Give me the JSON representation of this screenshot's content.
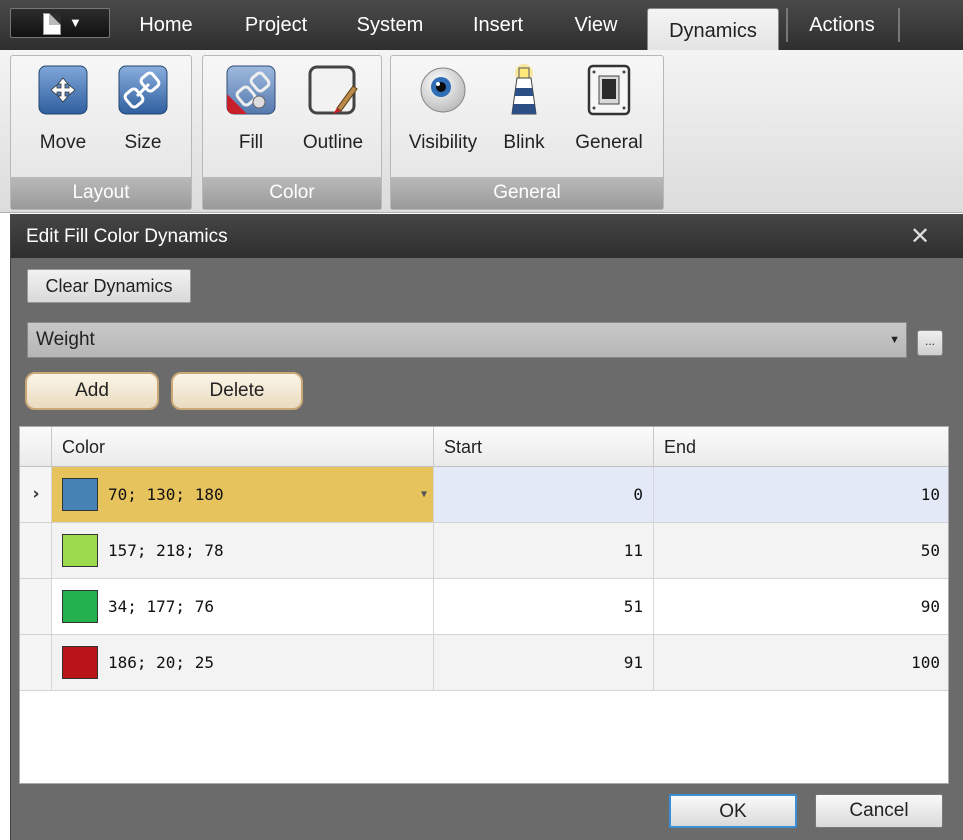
{
  "ribbon": {
    "tabs": [
      "Home",
      "Project",
      "System",
      "Insert",
      "View",
      "Dynamics",
      "Actions"
    ],
    "active_tab": "Dynamics",
    "groups": {
      "layout": {
        "label": "Layout",
        "buttons": [
          "Move",
          "Size"
        ]
      },
      "color": {
        "label": "Color",
        "buttons": [
          "Fill",
          "Outline"
        ]
      },
      "general": {
        "label": "General",
        "buttons": [
          "Visibility",
          "Blink",
          "General"
        ]
      }
    }
  },
  "dialog": {
    "title": "Edit Fill Color Dynamics",
    "clear_label": "Clear Dynamics",
    "source_value": "Weight",
    "browse_label": "...",
    "add_label": "Add",
    "delete_label": "Delete",
    "ok_label": "OK",
    "cancel_label": "Cancel"
  },
  "grid": {
    "columns": [
      "Color",
      "Start",
      "End"
    ],
    "rows": [
      {
        "color_text": "70; 130; 180",
        "swatch": "#4682B4",
        "start": "0",
        "end": "10",
        "current": true
      },
      {
        "color_text": "157; 218; 78",
        "swatch": "#9DDA4E",
        "start": "11",
        "end": "50",
        "current": false
      },
      {
        "color_text": "34; 177; 76",
        "swatch": "#22B14C",
        "start": "51",
        "end": "90",
        "current": false
      },
      {
        "color_text": "186; 20; 25",
        "swatch": "#BA1419",
        "start": "91",
        "end": "100",
        "current": false
      }
    ]
  },
  "colors": {
    "selected_cell": "#E7C35E",
    "current_row": "#E3E9F7",
    "alt_row": "#F3F3F3",
    "dialog_bg": "#6B6B6B"
  }
}
